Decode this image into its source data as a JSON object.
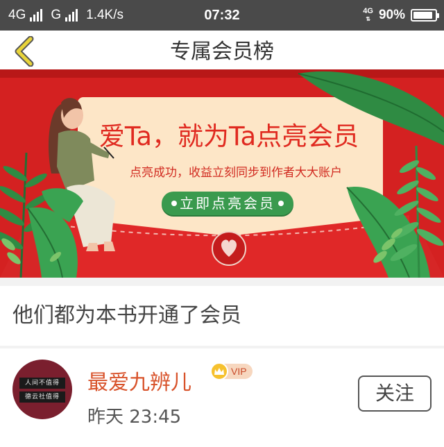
{
  "status_bar": {
    "network_1": "4G",
    "network_2": "G",
    "speed": "1.4K/s",
    "time": "07:32",
    "network_right": "4G",
    "battery": "90%",
    "battery_level": 0.9
  },
  "titlebar": {
    "title": "专属会员榜",
    "back_icon": "chevron-left-icon",
    "accent_color": "#e8d43a"
  },
  "banner": {
    "headline": "爱Ta，就为Ta点亮会员",
    "subline": "点亮成功，收益立刻同步到作者大大账户",
    "cta_label": "立即点亮会员",
    "colors": {
      "background": "#d42121",
      "card": "#fde6c7",
      "cta": "#3a9a4e",
      "headline": "#e02a20"
    }
  },
  "section": {
    "title": "他们都为本书开通了会员"
  },
  "members": [
    {
      "avatar_line_1": "人间不值得",
      "avatar_line_2": "德云社值得",
      "name": "最爱九辨儿",
      "badge": "VIP",
      "time": "昨天 23:45",
      "follow_label": "关注",
      "name_color": "#d8522a"
    }
  ]
}
